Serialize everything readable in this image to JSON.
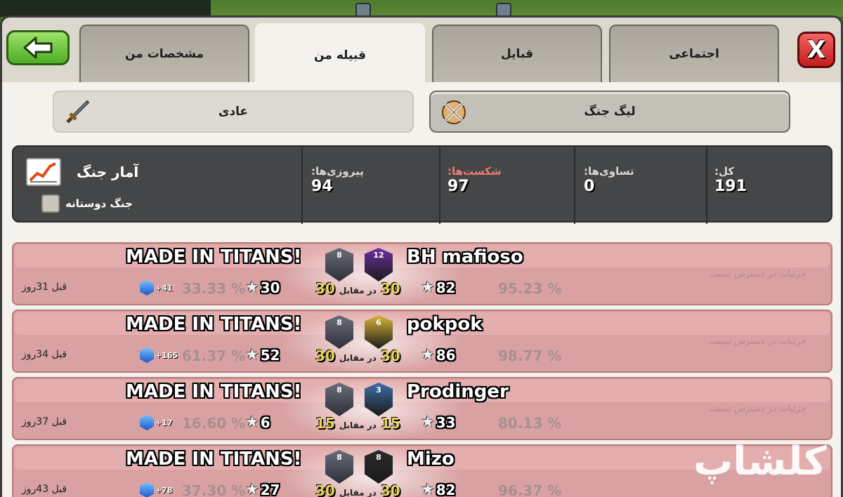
{
  "tabs": [
    {
      "label": "مشخصات من"
    },
    {
      "label": "قبیله من"
    },
    {
      "label": "قبایل"
    },
    {
      "label": "اجتماعی"
    }
  ],
  "close_label": "X",
  "modes": {
    "normal": "عادی",
    "league": "لیگ جنگ"
  },
  "stats": {
    "title": "آمار جنگ",
    "friendly_label": "جنگ دوستانه",
    "wins_label": "پیروزی‌ها:",
    "wins": "94",
    "losses_label": "شکست‌ها:",
    "losses": "97",
    "draws_label": "تساوی‌ها:",
    "draws": "0",
    "total_label": "کل:",
    "total": "191"
  },
  "colors": {
    "row_bg": "#d9a1a2",
    "panel_bg": "#f4f2ec",
    "stats_bg": "#444647"
  },
  "wars": [
    {
      "clan": "MADE IN TITANS!",
      "clan_level": "8",
      "opponent": "BH mafioso",
      "opp_level": "12",
      "opp_badge_color": "#6d2fa0",
      "ago": "قبل 31روز",
      "xp": "+41",
      "clan_pct": "33.33 %",
      "clan_stars": "30",
      "size_a": "30",
      "vs": "در مقابل",
      "size_b": "30",
      "opp_stars": "82",
      "opp_pct": "95.23 %",
      "na": "جزئیات در دسترس نیست"
    },
    {
      "clan": "MADE IN TITANS!",
      "clan_level": "8",
      "opponent": "pokpok",
      "opp_level": "6",
      "opp_badge_color": "#d9b53a",
      "ago": "قبل 34روز",
      "xp": "+165",
      "clan_pct": "61.37 %",
      "clan_stars": "52",
      "size_a": "30",
      "vs": "در مقابل",
      "size_b": "30",
      "opp_stars": "86",
      "opp_pct": "98.77 %",
      "na": "جزئیات در دسترس نیست"
    },
    {
      "clan": "MADE IN TITANS!",
      "clan_level": "8",
      "opponent": "Prodinger",
      "opp_level": "3",
      "opp_badge_color": "#3f6fa8",
      "ago": "قبل 37روز",
      "xp": "+17",
      "clan_pct": "16.60 %",
      "clan_stars": "6",
      "size_a": "15",
      "vs": "در مقابل",
      "size_b": "15",
      "opp_stars": "33",
      "opp_pct": "80.13 %",
      "na": "جزئیات در دسترس نیست"
    },
    {
      "clan": "MADE IN TITANS!",
      "clan_level": "8",
      "opponent": "Mizo",
      "opp_level": "8",
      "opp_badge_color": "#2b2b2b",
      "ago": "قبل 43روز",
      "xp": "+78",
      "clan_pct": "37.30 %",
      "clan_stars": "27",
      "size_a": "30",
      "vs": "در مقابل",
      "size_b": "30",
      "opp_stars": "82",
      "opp_pct": "96.37 %",
      "na": ""
    }
  ],
  "watermark": "کلشاپ",
  "icons": {
    "back": "arrow-left-icon",
    "close": "close-icon",
    "normal": "sword-icon",
    "league": "league-swords-icon",
    "chart": "war-stats-chart-icon",
    "star": "star-icon",
    "xp": "xp-gem-icon"
  }
}
